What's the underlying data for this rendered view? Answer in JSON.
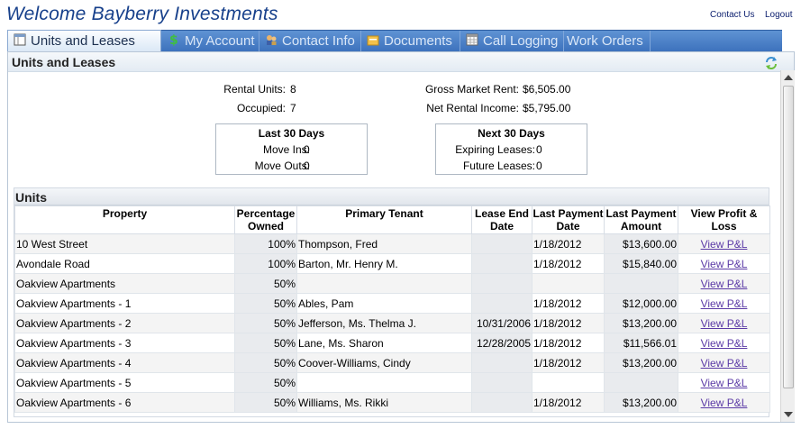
{
  "header": {
    "title": "Welcome Bayberry Investments",
    "contact_us": "Contact Us",
    "logout": "Logout"
  },
  "tabs": [
    {
      "label": "Units and Leases",
      "icon": "grid-icon"
    },
    {
      "label": "My Account",
      "icon": "dollar-icon"
    },
    {
      "label": "Contact Info",
      "icon": "contacts-icon"
    },
    {
      "label": "Documents",
      "icon": "folder-icon"
    },
    {
      "label": "Call Logging",
      "icon": "calendar-icon"
    },
    {
      "label": "Work Orders",
      "icon": ""
    }
  ],
  "panel": {
    "title": "Units and Leases"
  },
  "summary": {
    "rental_units_label": "Rental Units:",
    "rental_units_value": "8",
    "occupied_label": "Occupied:",
    "occupied_value": "7",
    "gross_rent_label": "Gross Market Rent:",
    "gross_rent_value": "$6,505.00",
    "net_income_label": "Net Rental Income:",
    "net_income_value": "$5,795.00"
  },
  "last30": {
    "title": "Last 30 Days",
    "move_ins_label": "Move Ins:",
    "move_ins_value": "0",
    "move_outs_label": "Move Outs:",
    "move_outs_value": "0"
  },
  "next30": {
    "title": "Next 30 Days",
    "expiring_label": "Expiring Leases:",
    "expiring_value": "0",
    "future_label": "Future Leases:",
    "future_value": "0"
  },
  "units": {
    "title": "Units",
    "columns": [
      "Property",
      "Percentage Owned",
      "Primary Tenant",
      "Lease End Date",
      "Last Payment Date",
      "Last Payment Amount",
      "View Profit & Loss"
    ],
    "rows": [
      {
        "property": "10 West Street",
        "pct": "100%",
        "tenant": "Thompson, Fred",
        "lease_end": "",
        "pay_date": "1/18/2012",
        "pay_amount": "$13,600.00",
        "link": "View P&L"
      },
      {
        "property": "Avondale Road",
        "pct": "100%",
        "tenant": "Barton, Mr. Henry M.",
        "lease_end": "",
        "pay_date": "1/18/2012",
        "pay_amount": "$15,840.00",
        "link": "View P&L"
      },
      {
        "property": "Oakview Apartments",
        "pct": "50%",
        "tenant": "",
        "lease_end": "",
        "pay_date": "",
        "pay_amount": "",
        "link": "View P&L"
      },
      {
        "property": "Oakview Apartments - 1",
        "pct": "50%",
        "tenant": "Ables, Pam",
        "lease_end": "",
        "pay_date": "1/18/2012",
        "pay_amount": "$12,000.00",
        "link": "View P&L"
      },
      {
        "property": "Oakview Apartments - 2",
        "pct": "50%",
        "tenant": "Jefferson, Ms. Thelma J.",
        "lease_end": "10/31/2006",
        "pay_date": "1/18/2012",
        "pay_amount": "$13,200.00",
        "link": "View P&L"
      },
      {
        "property": "Oakview Apartments - 3",
        "pct": "50%",
        "tenant": "Lane, Ms. Sharon",
        "lease_end": "12/28/2005",
        "pay_date": "1/18/2012",
        "pay_amount": "$11,566.01",
        "link": "View P&L"
      },
      {
        "property": "Oakview Apartments - 4",
        "pct": "50%",
        "tenant": "Coover-Williams, Cindy",
        "lease_end": "",
        "pay_date": "1/18/2012",
        "pay_amount": "$13,200.00",
        "link": "View P&L"
      },
      {
        "property": "Oakview Apartments - 5",
        "pct": "50%",
        "tenant": "",
        "lease_end": "",
        "pay_date": "",
        "pay_amount": "",
        "link": "View P&L"
      },
      {
        "property": "Oakview Apartments - 6",
        "pct": "50%",
        "tenant": "Williams, Ms. Rikki",
        "lease_end": "",
        "pay_date": "1/18/2012",
        "pay_amount": "$13,200.00",
        "link": "View P&L"
      }
    ]
  },
  "colors": {
    "title_blue": "#17408b",
    "tab_bar": "#3d72bd",
    "link_purple": "#5b3aa6"
  }
}
